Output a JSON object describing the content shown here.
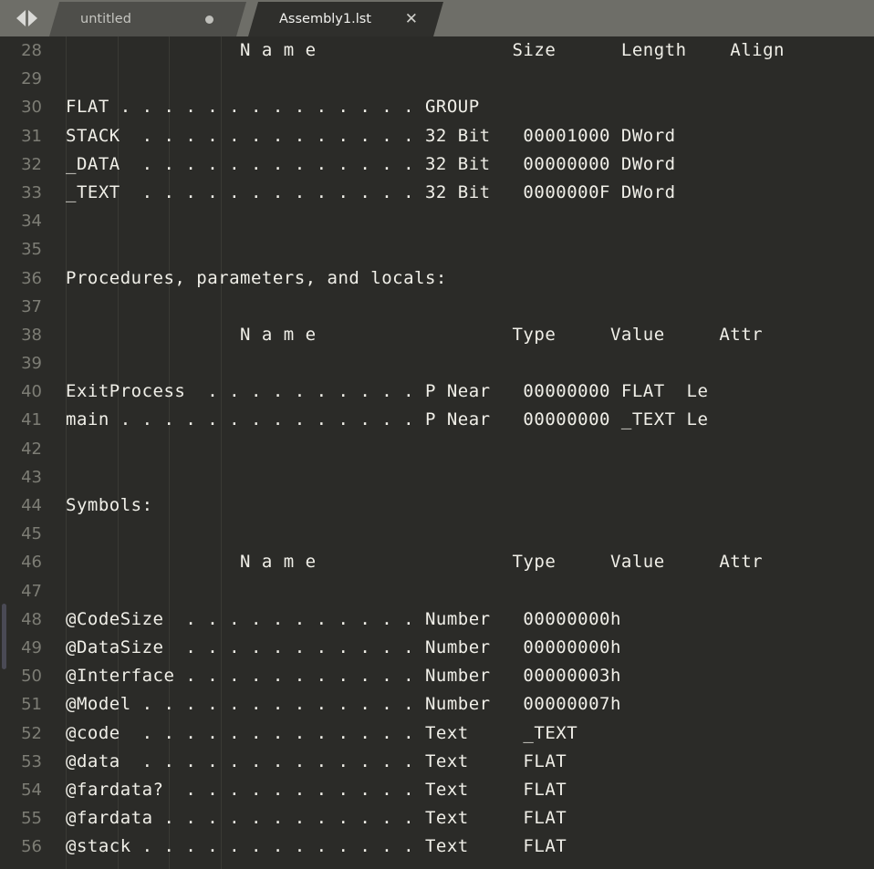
{
  "window": {
    "title": "Assembly1.lst"
  },
  "tabbar": {
    "nav": {
      "back_icon": "arrow-left-icon",
      "forward_icon": "arrow-right-icon"
    },
    "tabs": [
      {
        "label": "untitled",
        "active": false,
        "modified": true,
        "marker_icon": "modified-dot-icon"
      },
      {
        "label": "Assembly1.lst",
        "active": true,
        "modified": false,
        "close_icon": "close-icon",
        "close_glyph": "✕"
      }
    ]
  },
  "editor": {
    "first_visible_line": 28,
    "lines": [
      {
        "num": "28",
        "text": "                N a m e                  Size      Length    Align"
      },
      {
        "num": "29",
        "text": ""
      },
      {
        "num": "30",
        "text": "FLAT . . . . . . . . . . . . . . GROUP"
      },
      {
        "num": "31",
        "text": "STACK  . . . . . . . . . . . . . 32 Bit   00001000 DWord"
      },
      {
        "num": "32",
        "text": "_DATA  . . . . . . . . . . . . . 32 Bit   00000000 DWord"
      },
      {
        "num": "33",
        "text": "_TEXT  . . . . . . . . . . . . . 32 Bit   0000000F DWord"
      },
      {
        "num": "34",
        "text": ""
      },
      {
        "num": "35",
        "text": ""
      },
      {
        "num": "36",
        "text": "Procedures, parameters, and locals:"
      },
      {
        "num": "37",
        "text": ""
      },
      {
        "num": "38",
        "text": "                N a m e                  Type     Value     Attr"
      },
      {
        "num": "39",
        "text": ""
      },
      {
        "num": "40",
        "text": "ExitProcess  . . . . . . . . . . P Near   00000000 FLAT  Le"
      },
      {
        "num": "41",
        "text": "main . . . . . . . . . . . . . . P Near   00000000 _TEXT Le"
      },
      {
        "num": "42",
        "text": ""
      },
      {
        "num": "43",
        "text": ""
      },
      {
        "num": "44",
        "text": "Symbols:"
      },
      {
        "num": "45",
        "text": ""
      },
      {
        "num": "46",
        "text": "                N a m e                  Type     Value     Attr"
      },
      {
        "num": "47",
        "text": ""
      },
      {
        "num": "48",
        "text": "@CodeSize  . . . . . . . . . . . Number   00000000h"
      },
      {
        "num": "49",
        "text": "@DataSize  . . . . . . . . . . . Number   00000000h"
      },
      {
        "num": "50",
        "text": "@Interface . . . . . . . . . . . Number   00000003h"
      },
      {
        "num": "51",
        "text": "@Model . . . . . . . . . . . . . Number   00000007h"
      },
      {
        "num": "52",
        "text": "@code  . . . . . . . . . . . . . Text     _TEXT"
      },
      {
        "num": "53",
        "text": "@data  . . . . . . . . . . . . . Text     FLAT"
      },
      {
        "num": "54",
        "text": "@fardata?  . . . . . . . . . . . Text     FLAT"
      },
      {
        "num": "55",
        "text": "@fardata . . . . . . . . . . . . Text     FLAT"
      },
      {
        "num": "56",
        "text": "@stack . . . . . . . . . . . . . Text     FLAT"
      }
    ],
    "indent_guide_columns": [
      72,
      129,
      185,
      242
    ],
    "scrollbar": {
      "orientation": "vertical",
      "position": "left"
    }
  },
  "colors": {
    "editor_background": "#2b2b28",
    "tabbar_background": "#6e6e68",
    "active_tab_background": "#2f2f2c",
    "inactive_tab_background": "#4e4e4a",
    "text": "#f0efe8",
    "line_number": "#7d7d75",
    "indent_guide": "#3a3a35",
    "scrollbar_thumb": "#4a4a55"
  }
}
